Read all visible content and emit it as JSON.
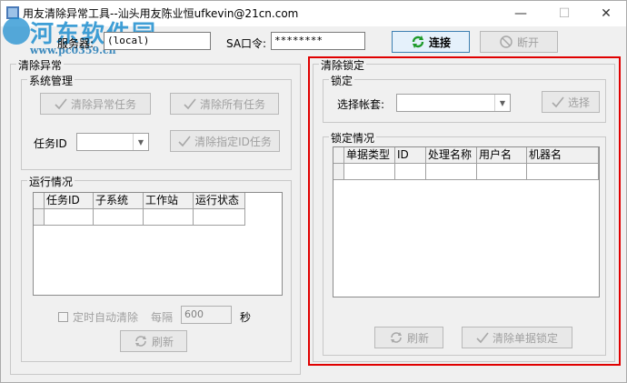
{
  "window": {
    "title": "用友清除异常工具--汕头用友陈业恒ufkevin@21cn.com",
    "minimize_glyph": "—",
    "maximize_glyph": "☐",
    "close_glyph": "✕"
  },
  "watermark": {
    "line1": "河东软件园",
    "line2": "www.pc0359.cn"
  },
  "connection": {
    "server_label": "服务器:",
    "server_value": "(local)",
    "sa_label": "SA口令:",
    "sa_value": "********",
    "connect_label": "连接",
    "disconnect_label": "断开"
  },
  "clear_exception": {
    "title": "清除异常",
    "system_mgmt_title": "系统管理",
    "clear_exception_tasks": "清除异常任务",
    "clear_all_tasks": "清除所有任务",
    "task_id_label": "任务ID",
    "clear_specified_task": "清除指定ID任务",
    "running_title": "运行情况",
    "running_columns": [
      "任务ID",
      "子系统",
      "工作站",
      "运行状态"
    ],
    "auto_clear_label": "定时自动清除",
    "interval_label": "每隔",
    "interval_value": "600",
    "seconds_label": "秒",
    "refresh_label": "刷新"
  },
  "clear_lock": {
    "title": "清除锁定",
    "lock_title": "锁定",
    "select_account_label": "选择帐套:",
    "select_label": "选择",
    "lock_status_title": "锁定情况",
    "lock_columns": [
      "单据类型",
      "ID",
      "处理名称",
      "用户名",
      "机器名"
    ],
    "refresh_label": "刷新",
    "clear_doc_lock_label": "清除单据锁定"
  }
}
